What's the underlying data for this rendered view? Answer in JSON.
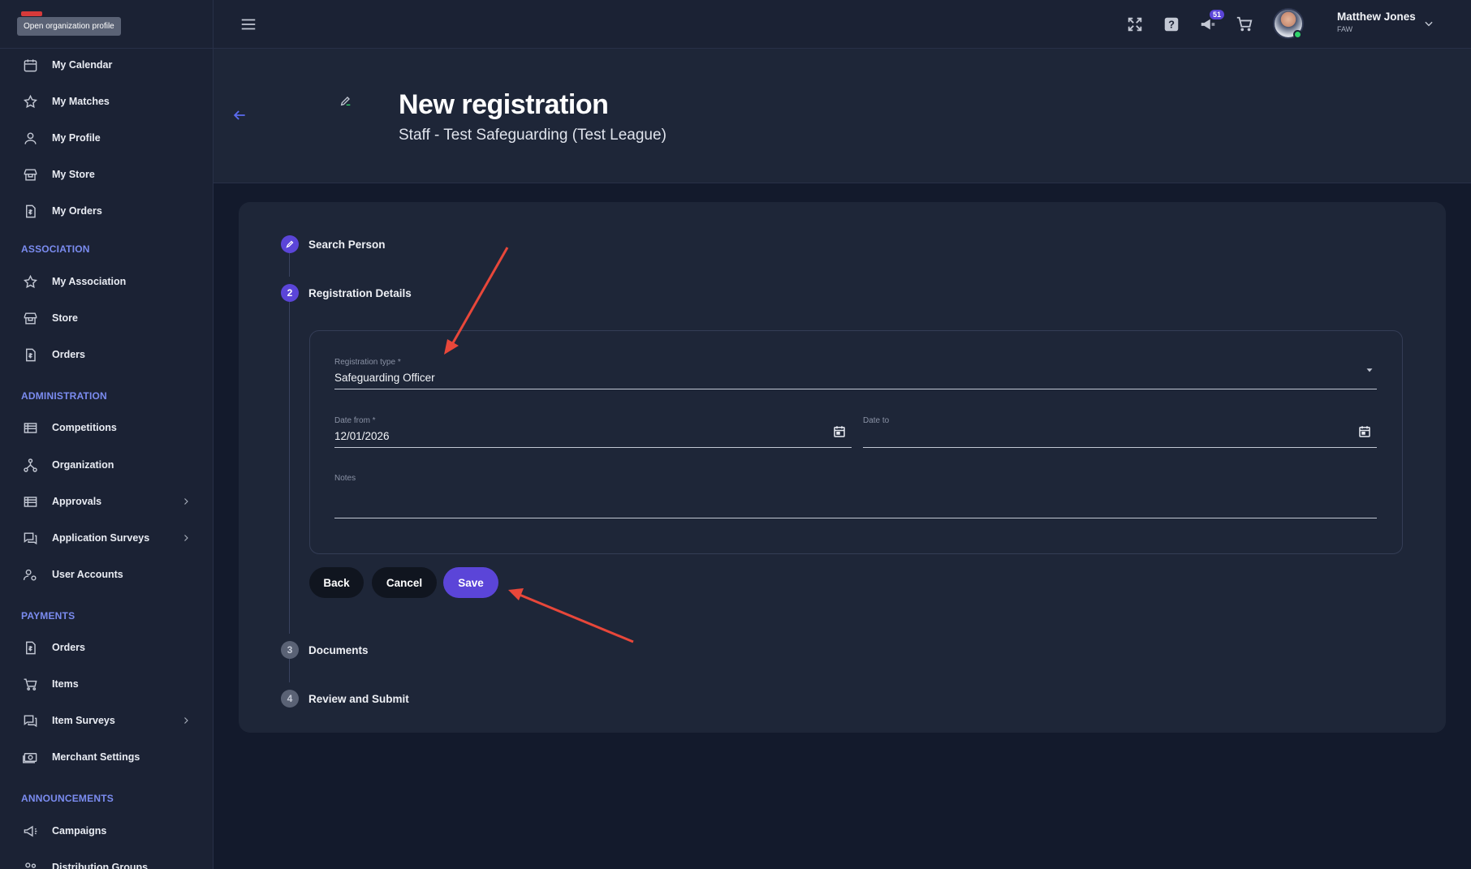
{
  "sidebar": {
    "tooltip": "Open organization profile",
    "items": [
      {
        "label": "My Calendar"
      },
      {
        "label": "My Matches"
      },
      {
        "label": "My Profile"
      },
      {
        "label": "My Store"
      },
      {
        "label": "My Orders"
      },
      {
        "label": "My Association"
      },
      {
        "label": "Store"
      },
      {
        "label": "Orders"
      },
      {
        "label": "Competitions"
      },
      {
        "label": "Organization"
      },
      {
        "label": "Approvals"
      },
      {
        "label": "Application Surveys"
      },
      {
        "label": "User Accounts"
      },
      {
        "label": "Orders"
      },
      {
        "label": "Items"
      },
      {
        "label": "Item Surveys"
      },
      {
        "label": "Merchant Settings"
      },
      {
        "label": "Campaigns"
      },
      {
        "label": "Distribution Groups"
      }
    ],
    "sections": {
      "association": "ASSOCIATION",
      "administration": "ADMINISTRATION",
      "payments": "PAYMENTS",
      "announcements": "ANNOUNCEMENTS"
    }
  },
  "topbar": {
    "notifications_count": "51",
    "user_name": "Matthew Jones",
    "user_org": "FAW"
  },
  "header": {
    "title": "New registration",
    "subtitle": "Staff - Test Safeguarding (Test League)"
  },
  "stepper": {
    "steps": [
      {
        "number": "",
        "label": "Search Person"
      },
      {
        "number": "2",
        "label": "Registration Details"
      },
      {
        "number": "3",
        "label": "Documents"
      },
      {
        "number": "4",
        "label": "Review and Submit"
      }
    ]
  },
  "form": {
    "registration_type_label": "Registration type *",
    "registration_type_value": "Safeguarding Officer",
    "date_from_label": "Date from *",
    "date_from_value": "12/01/2026",
    "date_to_label": "Date to",
    "date_to_value": "",
    "notes_label": "Notes",
    "notes_value": ""
  },
  "actions": {
    "back": "Back",
    "cancel": "Cancel",
    "save": "Save"
  },
  "colors": {
    "accent": "#5b45d8",
    "section_heading": "#7b8cf0",
    "annotation": "#e8473a"
  }
}
